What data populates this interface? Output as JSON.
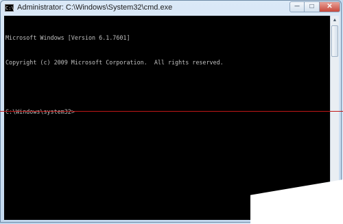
{
  "window": {
    "title": "Administrator: C:\\Windows\\System32\\cmd.exe",
    "app_icon_label": "C:\\"
  },
  "controls": {
    "minimize": "─",
    "maximize": "□",
    "close": "✕"
  },
  "console": {
    "lines": [
      "Microsoft Windows [Version 6.1.7601]",
      "Copyright (c) 2009 Microsoft Corporation.  All rights reserved.",
      "",
      "C:\\Windows\\system32>"
    ]
  },
  "scrollbar": {
    "up_arrow": "▲",
    "down_arrow": "▼"
  },
  "colors": {
    "console_bg": "#000000",
    "console_fg": "#c0c0c0",
    "annotation_line": "#c21818"
  }
}
